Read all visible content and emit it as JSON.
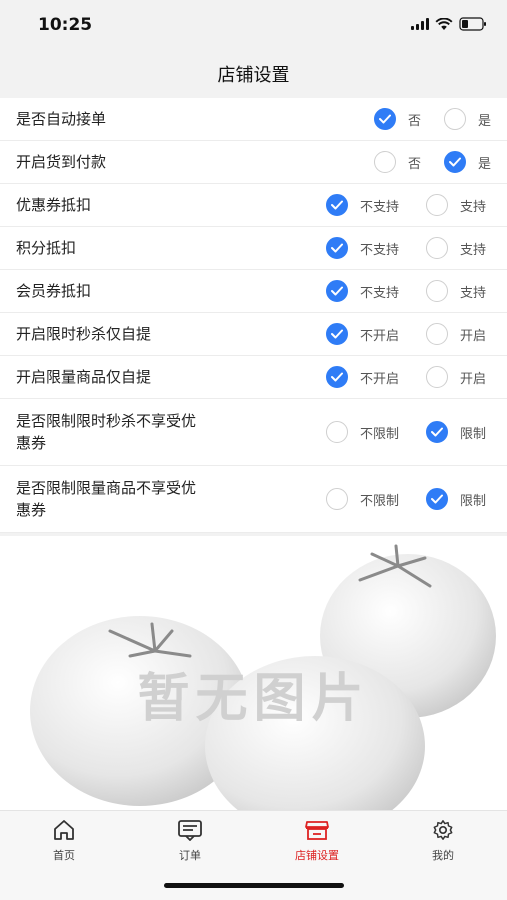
{
  "status_bar": {
    "time": "10:25"
  },
  "header": {
    "title": "店铺设置"
  },
  "settings": [
    {
      "label": "是否自动接单",
      "options": [
        "否",
        "是"
      ],
      "selected": 0
    },
    {
      "label": "开启货到付款",
      "options": [
        "否",
        "是"
      ],
      "selected": 1
    },
    {
      "label": "优惠券抵扣",
      "options": [
        "不支持",
        "支持"
      ],
      "selected": 0
    },
    {
      "label": "积分抵扣",
      "options": [
        "不支持",
        "支持"
      ],
      "selected": 0
    },
    {
      "label": "会员券抵扣",
      "options": [
        "不支持",
        "支持"
      ],
      "selected": 0
    },
    {
      "label": "开启限时秒杀仅自提",
      "options": [
        "不开启",
        "开启"
      ],
      "selected": 0
    },
    {
      "label": "开启限量商品仅自提",
      "options": [
        "不开启",
        "开启"
      ],
      "selected": 0
    },
    {
      "label": "是否限制限时秒杀不享受优惠券",
      "options": [
        "不限制",
        "限制"
      ],
      "selected": 1
    },
    {
      "label": "是否限制限量商品不享受优惠券",
      "options": [
        "不限制",
        "限制"
      ],
      "selected": 1
    }
  ],
  "placeholder": {
    "text": "暂无图片"
  },
  "tabbar": {
    "items": [
      {
        "label": "首页",
        "icon": "home-icon"
      },
      {
        "label": "订单",
        "icon": "order-icon"
      },
      {
        "label": "店铺设置",
        "icon": "store-icon",
        "active": true
      },
      {
        "label": "我的",
        "icon": "gear-icon"
      }
    ]
  },
  "colors": {
    "accent": "#2f7cf6",
    "active_tab": "#dd2222"
  }
}
